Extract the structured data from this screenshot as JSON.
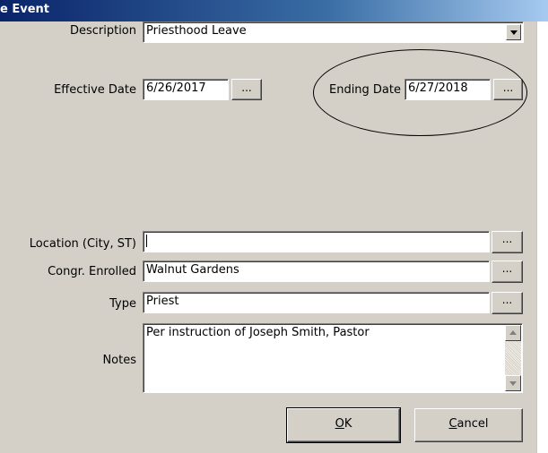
{
  "window": {
    "title": "e Event"
  },
  "form": {
    "description": {
      "label": "Description",
      "value": "Priesthood Leave"
    },
    "effective_date": {
      "label": "Effective Date",
      "value": "6/26/2017",
      "picker_label": "..."
    },
    "ending_date": {
      "label": "Ending Date",
      "value": "6/27/2018",
      "picker_label": "..."
    },
    "location": {
      "label": "Location (City, ST)",
      "value": "",
      "picker_label": "..."
    },
    "congregation": {
      "label": "Congr. Enrolled",
      "value": "Walnut Gardens",
      "picker_label": "..."
    },
    "type": {
      "label": "Type",
      "value": "Priest",
      "picker_label": "..."
    },
    "notes": {
      "label": "Notes",
      "value": "Per instruction of Joseph Smith, Pastor"
    }
  },
  "buttons": {
    "ok": {
      "accel": "O",
      "rest": "K"
    },
    "cancel": {
      "accel": "C",
      "rest": "ancel"
    }
  },
  "icons": {
    "combo": "chevron-down-icon",
    "scroll_up": "arrow-up-icon",
    "scroll_down": "arrow-down-icon"
  }
}
